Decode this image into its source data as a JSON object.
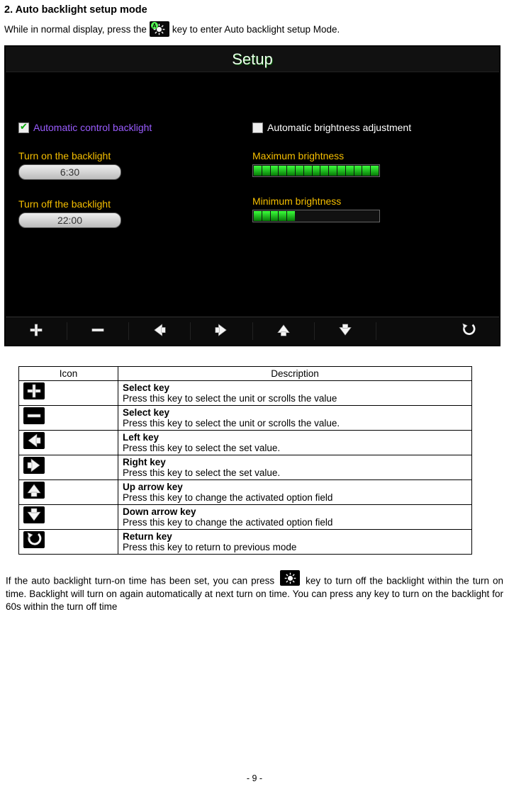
{
  "heading": "2.  Auto backlight setup mode",
  "intro_pre": "While in normal display, press the ",
  "intro_post": " key to enter Auto backlight setup Mode.",
  "setup": {
    "title": "Setup",
    "auto_ctl_checked": true,
    "auto_ctl_label": "Automatic control backlight",
    "auto_bright_checked": false,
    "auto_bright_label": "Automatic brightness adjustment",
    "turn_on_label": "Turn on the backlight",
    "turn_on_value": "6:30",
    "turn_off_label": "Turn off the backlight",
    "turn_off_value": "22:00",
    "max_bright_label": "Maximum brightness",
    "max_bright_segs": 15,
    "max_bright_on": 15,
    "min_bright_label": "Minimum brightness",
    "min_bright_segs": 15,
    "min_bright_on": 5
  },
  "table": {
    "h_icon": "Icon",
    "h_desc": "Description",
    "rows": [
      {
        "icon": "plus",
        "name": "Select key",
        "text": "Press this key to select the unit or scrolls the value"
      },
      {
        "icon": "minus",
        "name": "Select key",
        "text": "Press this key to select the unit or scrolls the value."
      },
      {
        "icon": "left",
        "name": "Left key",
        "text": "Press this key to select the set value."
      },
      {
        "icon": "right",
        "name": "Right key",
        "text": "Press this key to select the set value."
      },
      {
        "icon": "up",
        "name": "Up arrow key",
        "text": "Press this key to change the activated option field"
      },
      {
        "icon": "down",
        "name": "Down arrow key",
        "text": "Press this key to change the activated option field"
      },
      {
        "icon": "return",
        "name": "Return key",
        "text": "Press this key to return to previous mode"
      }
    ]
  },
  "after_pre": "If the auto backlight turn-on time has been set, you can press ",
  "after_post": " key to turn off the backlight within the turn on time. Backlight will turn on again automatically at next turn on time. You can press any key to turn on the backlight for 60s within the turn off time",
  "page_number": "- 9 -",
  "toolbar_icons": [
    "plus",
    "minus",
    "left",
    "right",
    "up",
    "down",
    "spacer",
    "return"
  ]
}
